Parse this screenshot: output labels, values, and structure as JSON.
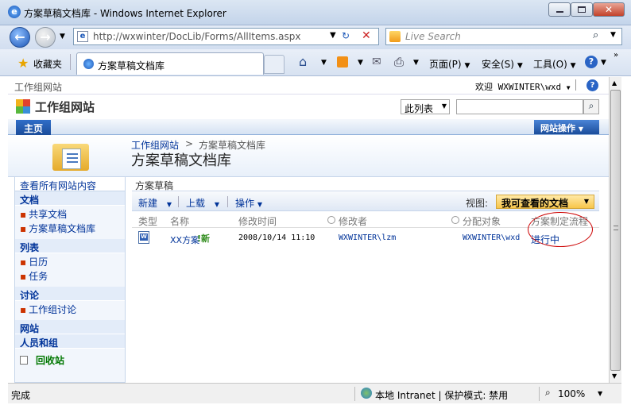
{
  "window": {
    "title": "方案草稿文档库 - Windows Internet Explorer"
  },
  "address": {
    "url": "http://wxwinter/DocLib/Forms/AllItems.aspx",
    "search_placeholder": "Live Search"
  },
  "favbar": {
    "favorites_label": "收藏夹",
    "tab_title": "方案草稿文档库",
    "page_menu": "页面(P)",
    "safety_menu": "安全(S)",
    "tools_menu": "工具(O)"
  },
  "sp": {
    "breadcrumb_top": "工作组网站",
    "welcome": "欢迎 WXWINTER\\wxd",
    "site_title": "工作组网站",
    "search_scope": "此列表",
    "home_tab": "主页",
    "site_actions": "网站操作",
    "crumb_site": "工作组网站",
    "crumb_sep": ">",
    "crumb_lib": "方案草稿文档库",
    "page_title": "方案草稿文档库"
  },
  "quicklaunch": {
    "view_all": "查看所有网站内容",
    "docs_header": "文档",
    "docs_items": [
      "共享文档",
      "方案草稿文档库"
    ],
    "lists_header": "列表",
    "lists_items": [
      "日历",
      "任务"
    ],
    "disc_header": "讨论",
    "disc_items": [
      "工作组讨论"
    ],
    "sites_header": "网站",
    "people_header": "人员和组",
    "recycle": "回收站"
  },
  "list": {
    "title": "方案草稿",
    "new_label": "新建",
    "upload_label": "上载",
    "actions_label": "操作",
    "view_label": "视图:",
    "view_value": "我可查看的文档",
    "columns": [
      "类型",
      "名称",
      "修改时间",
      "修改者",
      "分配对象",
      "方案制定流程"
    ],
    "rows": [
      {
        "name": "XX方案",
        "new_badge": "!新",
        "modified": "2008/10/14 11:10",
        "modified_by": "WXWINTER\\lzm",
        "assigned": "WXWINTER\\wxd",
        "status": "进行中"
      }
    ]
  },
  "status": {
    "left": "完成",
    "zone": "本地 Intranet | 保护模式: 禁用",
    "zoom": "100%"
  }
}
